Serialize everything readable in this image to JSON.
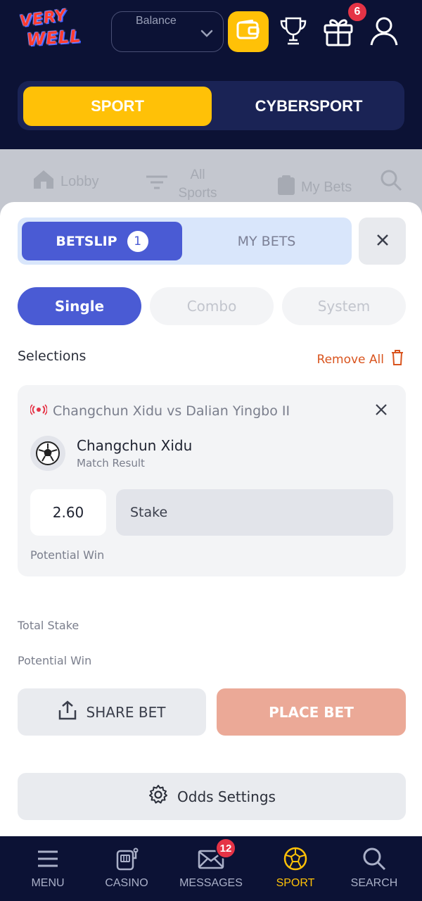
{
  "header": {
    "logo_line1": "VERY",
    "logo_line2": "WELL",
    "balance_label": "Balance",
    "gift_badge": "6"
  },
  "switcher": {
    "sport": "SPORT",
    "cybersport": "CYBERSPORT"
  },
  "background_nav": {
    "lobby": "Lobby",
    "all_sports": "All Sports",
    "my_bets": "My Bets"
  },
  "betslip": {
    "tab_betslip": "BETSLIP",
    "betslip_count": "1",
    "tab_my_bets": "MY BETS",
    "types": [
      "Single",
      "Combo",
      "System"
    ],
    "selections_title": "Selections",
    "remove_all": "Remove All",
    "selection": {
      "match": "Changchun Xidu vs Dalian Yingbo II",
      "team": "Changchun Xidu",
      "market": "Match Result",
      "odds": "2.60",
      "stake_placeholder": "Stake",
      "potential_win_label": "Potential Win"
    },
    "total_stake_label": "Total Stake",
    "potential_win_label": "Potential Win",
    "share_bet": "SHARE BET",
    "place_bet": "PLACE BET",
    "odds_settings": "Odds Settings"
  },
  "bottom_nav": {
    "menu": "MENU",
    "casino": "CASINO",
    "messages": "MESSAGES",
    "messages_badge": "12",
    "sport": "SPORT",
    "search": "SEARCH"
  },
  "colors": {
    "header_bg": "#0c1235",
    "accent_yellow": "#ffc107",
    "primary_blue": "#4a5bd4",
    "place_bet_disabled": "#eba997",
    "remove_all": "#d9541e",
    "badge_red": "#e53346"
  }
}
